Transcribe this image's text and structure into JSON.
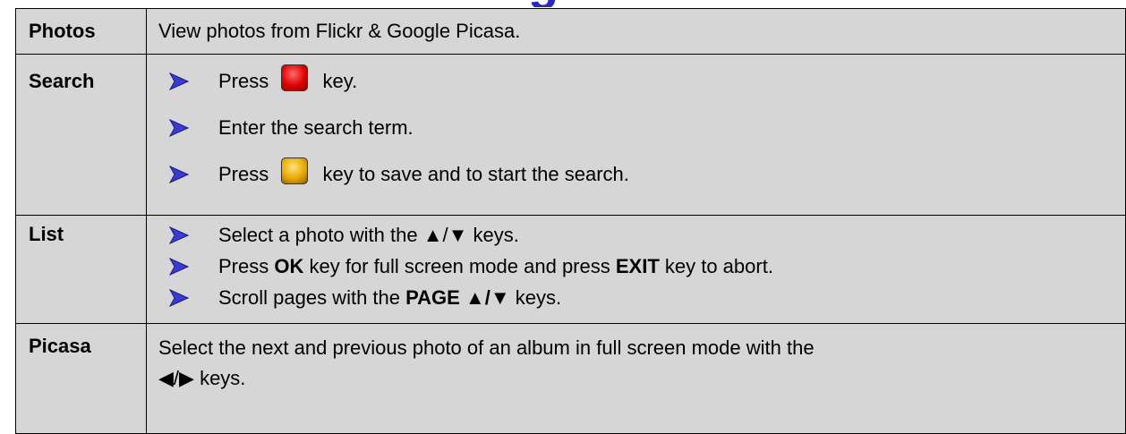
{
  "heading_fragment": "g",
  "rows": {
    "photos": {
      "label": "Photos",
      "text": "View photos from Flickr & Google Picasa."
    },
    "search": {
      "label": "Search",
      "bullets": [
        {
          "before": "Press",
          "key": "red-key",
          "after": "key."
        },
        {
          "text": "Enter the search term."
        },
        {
          "before": "Press",
          "key": "yellow-key",
          "after": "key to save and to start the search."
        }
      ]
    },
    "list": {
      "label": "List",
      "bullets": [
        {
          "text": "Select a photo with the ▲/▼ keys."
        },
        {
          "p1": "Press ",
          "ok": "OK",
          "p2": " key for full screen mode and press ",
          "exit": "EXIT",
          "p3": " key to abort."
        },
        {
          "p1": "Scroll pages with the ",
          "page": "PAGE ▲/▼",
          "p2": " keys."
        }
      ]
    },
    "picasa": {
      "label": "Picasa",
      "text_line1": "Select the next and previous photo of an album in full screen mode with the",
      "text_line2": "◀/▶ keys."
    }
  },
  "colors": {
    "cell_background": "#d6d6d6",
    "bullet_arrow": "#2a2ab8",
    "red_key": "#e00000",
    "yellow_key": "#e6a800",
    "heading": "#2a2ab8"
  }
}
